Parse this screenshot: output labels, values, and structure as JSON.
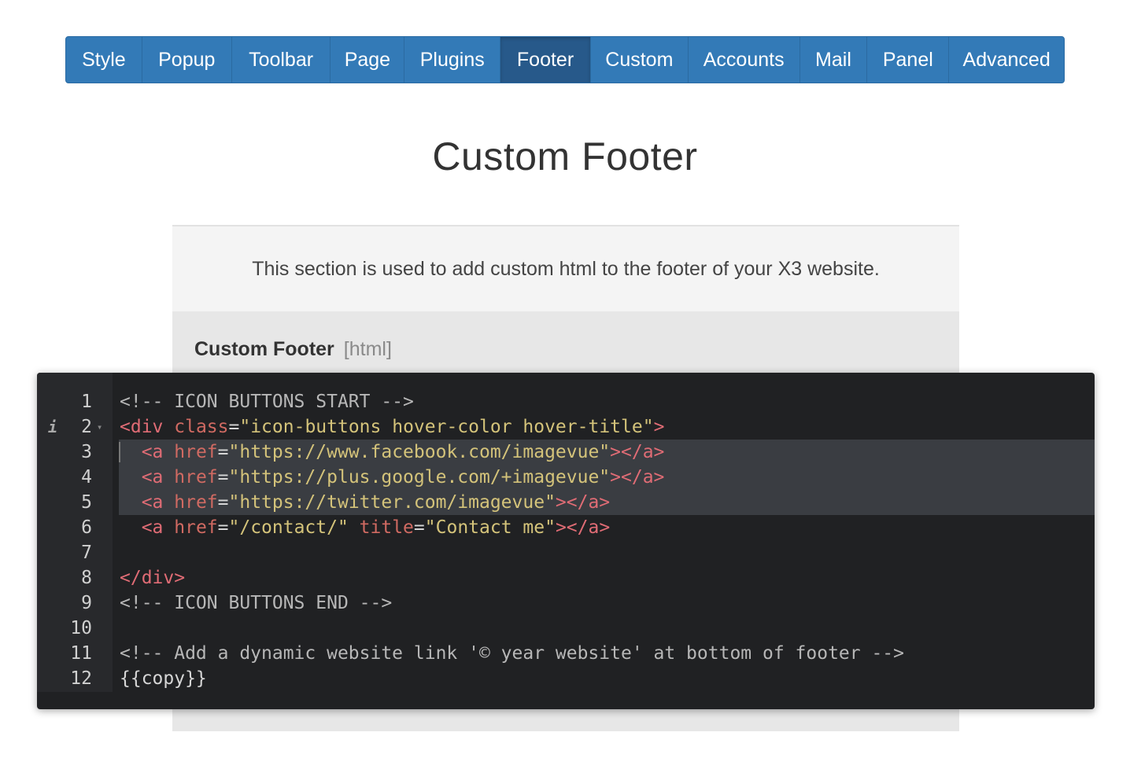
{
  "tabs": [
    {
      "label": "Style",
      "active": false
    },
    {
      "label": "Popup",
      "active": false
    },
    {
      "label": "Toolbar",
      "active": false
    },
    {
      "label": "Page",
      "active": false
    },
    {
      "label": "Plugins",
      "active": false
    },
    {
      "label": "Footer",
      "active": true
    },
    {
      "label": "Custom",
      "active": false
    },
    {
      "label": "Accounts",
      "active": false
    },
    {
      "label": "Mail",
      "active": false
    },
    {
      "label": "Panel",
      "active": false
    },
    {
      "label": "Advanced",
      "active": false
    }
  ],
  "page_title": "Custom Footer",
  "description": "This section is used to add custom html to the footer of your X3 website.",
  "field": {
    "label": "Custom Footer",
    "hint": "[html]"
  },
  "editor": {
    "lines": [
      {
        "n": "1",
        "segments": [
          {
            "t": "<!-- ICON BUTTONS START -->",
            "c": "comment"
          }
        ]
      },
      {
        "n": "2",
        "segments": [
          {
            "t": "<div ",
            "c": "tag"
          },
          {
            "t": "class",
            "c": "attr"
          },
          {
            "t": "=",
            "c": "plain"
          },
          {
            "t": "\"icon-buttons hover-color hover-title\"",
            "c": "str"
          },
          {
            "t": ">",
            "c": "tag"
          }
        ]
      },
      {
        "n": "3",
        "segments": [
          {
            "t": "  <a ",
            "c": "tag"
          },
          {
            "t": "href",
            "c": "attr"
          },
          {
            "t": "=",
            "c": "plain"
          },
          {
            "t": "\"https://www.facebook.com/imagevue\"",
            "c": "str"
          },
          {
            "t": "></a>",
            "c": "tag"
          }
        ]
      },
      {
        "n": "4",
        "segments": [
          {
            "t": "  <a ",
            "c": "tag"
          },
          {
            "t": "href",
            "c": "attr"
          },
          {
            "t": "=",
            "c": "plain"
          },
          {
            "t": "\"https://plus.google.com/+imagevue\"",
            "c": "str"
          },
          {
            "t": "></a>",
            "c": "tag"
          }
        ]
      },
      {
        "n": "5",
        "segments": [
          {
            "t": "  <a ",
            "c": "tag"
          },
          {
            "t": "href",
            "c": "attr"
          },
          {
            "t": "=",
            "c": "plain"
          },
          {
            "t": "\"https://twitter.com/imagevue\"",
            "c": "str"
          },
          {
            "t": "></a>",
            "c": "tag"
          }
        ]
      },
      {
        "n": "6",
        "segments": [
          {
            "t": "  <a ",
            "c": "tag"
          },
          {
            "t": "href",
            "c": "attr"
          },
          {
            "t": "=",
            "c": "plain"
          },
          {
            "t": "\"/contact/\" ",
            "c": "str"
          },
          {
            "t": "title",
            "c": "attr"
          },
          {
            "t": "=",
            "c": "plain"
          },
          {
            "t": "\"Contact me\"",
            "c": "str"
          },
          {
            "t": "></a>",
            "c": "tag"
          }
        ]
      },
      {
        "n": "7",
        "segments": []
      },
      {
        "n": "8",
        "segments": [
          {
            "t": "</div>",
            "c": "tag"
          }
        ]
      },
      {
        "n": "9",
        "segments": [
          {
            "t": "<!-- ICON BUTTONS END -->",
            "c": "comment"
          }
        ]
      },
      {
        "n": "10",
        "segments": []
      },
      {
        "n": "11",
        "segments": [
          {
            "t": "<!-- Add a dynamic website link '© year website' at bottom of footer -->",
            "c": "comment"
          }
        ]
      },
      {
        "n": "12",
        "segments": [
          {
            "t": "{{copy}}",
            "c": "plain"
          }
        ]
      }
    ],
    "selected_lines": [
      "3",
      "4",
      "5"
    ],
    "info_line": "2",
    "fold_line": "2",
    "info_icon": "info-icon",
    "fold_icon": "fold-arrow-icon"
  },
  "colors": {
    "tab_bg": "#337ab7",
    "tab_active_bg": "#27598a",
    "editor_bg": "#202123",
    "comment": "#b7b7b7",
    "tag": "#e06c75",
    "string": "#d4c37a"
  }
}
